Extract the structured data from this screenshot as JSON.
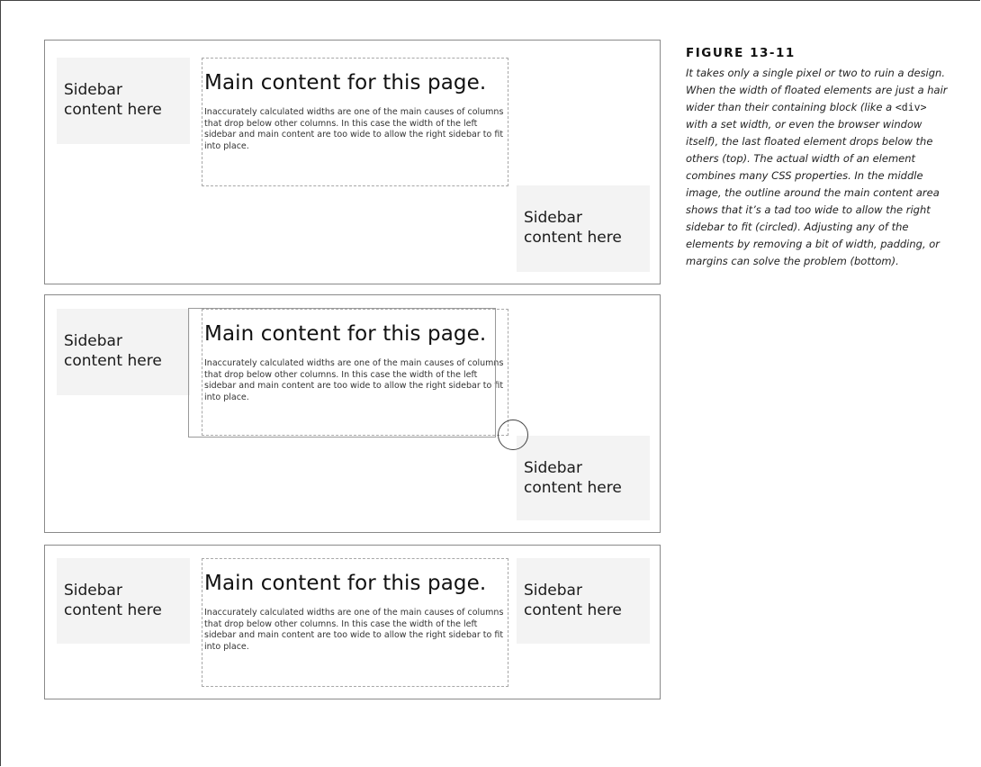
{
  "figure": {
    "label": "FIGURE 13-11",
    "caption_before_code": "It takes only a single pixel or two to ruin a design. When the width of floated elements are just a hair wider than their containing block (like a ",
    "caption_code": "<div>",
    "caption_after_code": " with a set width, or even the browser window itself), the last floated element drops below the others (top). The actual width of an element combines many CSS properties. In the middle image, the outline around the main content area shows that it’s a tad too wide to allow the right sidebar to fit (circled). Adjusting any of the elements by removing a bit of width, padding, or margins can solve the problem (bottom)."
  },
  "panels": [
    {
      "left_sidebar": {
        "line1": "Sidebar",
        "line2": "content here"
      },
      "main": {
        "title": "Main content for this page.",
        "text": "Inaccurately calculated widths are one of the main causes of columns that drop below other columns. In this case the width of the left sidebar and main content are too wide to allow the right sidebar to fit into place."
      },
      "right_sidebar": {
        "line1": "Sidebar",
        "line2": "content here"
      }
    },
    {
      "left_sidebar": {
        "line1": "Sidebar",
        "line2": "content here"
      },
      "main": {
        "title": "Main content for this page.",
        "text": "Inaccurately calculated widths are one of the main causes of columns that drop below other columns. In this case the width of the left sidebar and main content are too wide to allow the right sidebar to fit into place."
      },
      "right_sidebar": {
        "line1": "Sidebar",
        "line2": "content here"
      }
    },
    {
      "left_sidebar": {
        "line1": "Sidebar",
        "line2": "content here"
      },
      "main": {
        "title": "Main content for this page.",
        "text": "Inaccurately calculated widths are one of the main causes of columns that drop below other columns. In this case the width of the left sidebar and main content are too wide to allow the right sidebar to fit into place."
      },
      "right_sidebar": {
        "line1": "Sidebar",
        "line2": "content here"
      }
    }
  ],
  "icons": {
    "circle_marker": "circle-highlight-icon"
  }
}
